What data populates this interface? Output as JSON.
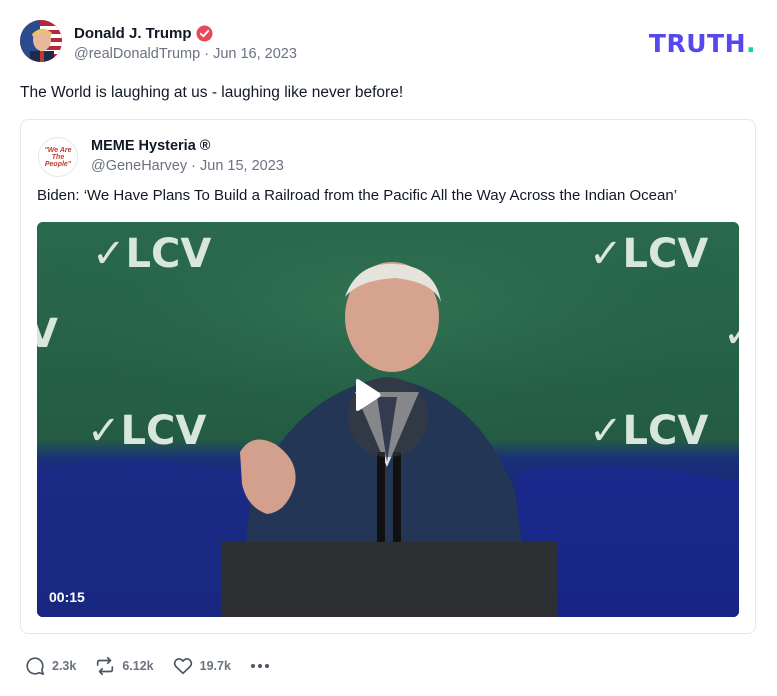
{
  "post": {
    "author_name": "Donald J. Trump",
    "handle": "@realDonaldTrump",
    "date": "Jun 16, 2023",
    "meta": "@realDonaldTrump · Jun 16, 2023",
    "text": "The World is laughing at us - laughing like never before!"
  },
  "brand": {
    "text": "TRUTH",
    "dot": ".",
    "color": "#5448ee",
    "dot_color": "#17d2a0"
  },
  "quote": {
    "author_name": "MEME Hysteria ®",
    "handle": "@GeneHarvey",
    "date": "Jun 15, 2023",
    "meta": "@GeneHarvey · Jun 15, 2023",
    "avatar_text": "\"We Are The People\"",
    "text": "Biden: ‘We Have Plans To Build a Railroad from the Pacific All the Way Across the Indian Ocean’",
    "video": {
      "duration": "00:15",
      "banner_text": "✓LCV"
    }
  },
  "actions": {
    "replies": "2.3k",
    "retruths": "6.12k",
    "likes": "19.7k"
  },
  "colors": {
    "verified": "#e8485c",
    "muted": "#6b7280",
    "text": "#111827"
  }
}
